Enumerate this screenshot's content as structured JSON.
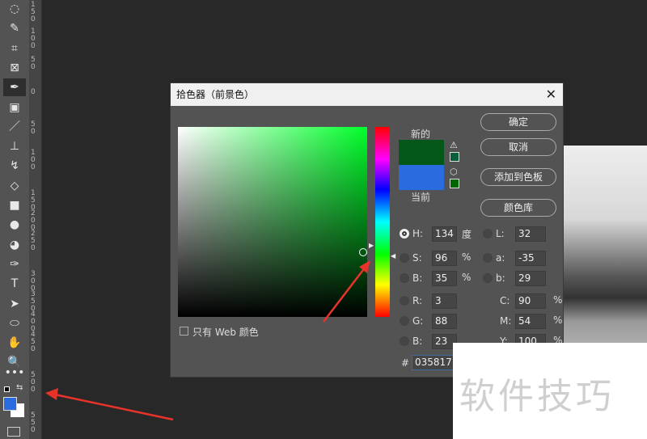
{
  "toolbar": {
    "tools": [
      {
        "name": "lasso-tool",
        "glyph": "◌"
      },
      {
        "name": "magic-wand-tool",
        "glyph": "✎"
      },
      {
        "name": "crop-tool",
        "glyph": "⌗"
      },
      {
        "name": "frame-tool",
        "glyph": "⊠"
      },
      {
        "name": "eyedropper-tool",
        "glyph": "✒",
        "active": true
      },
      {
        "name": "patch-tool",
        "glyph": "▣"
      },
      {
        "name": "brush-tool",
        "glyph": "／"
      },
      {
        "name": "stamp-tool",
        "glyph": "⊥"
      },
      {
        "name": "history-brush-tool",
        "glyph": "↯"
      },
      {
        "name": "eraser-tool",
        "glyph": "◇"
      },
      {
        "name": "gradient-tool",
        "glyph": "■"
      },
      {
        "name": "blur-tool",
        "glyph": "●"
      },
      {
        "name": "dodge-tool",
        "glyph": "◕"
      },
      {
        "name": "pen-tool",
        "glyph": "✑"
      },
      {
        "name": "type-tool",
        "glyph": "T"
      },
      {
        "name": "path-select-tool",
        "glyph": "➤"
      },
      {
        "name": "ellipse-tool",
        "glyph": "⬭"
      },
      {
        "name": "hand-tool",
        "glyph": "✋"
      },
      {
        "name": "zoom-tool",
        "glyph": "🔍"
      },
      {
        "name": "more-tools",
        "glyph": "•••"
      }
    ],
    "foreground_color": "#2b6be0",
    "background_color": "#ffffff"
  },
  "ruler": {
    "labels": [
      "150",
      "100",
      "50",
      "0",
      "50",
      "100",
      "150",
      "200",
      "250",
      "300",
      "350",
      "400",
      "450",
      "500",
      "550"
    ]
  },
  "dialog": {
    "title": "拾色器（前景色）",
    "new_label": "新的",
    "current_label": "当前",
    "new_color": "#035817",
    "current_color": "#2b6be0",
    "buttons": {
      "ok": "确定",
      "cancel": "取消",
      "add_swatch": "添加到色板",
      "color_library": "颜色库"
    },
    "fields": {
      "H": {
        "label": "H:",
        "value": "134",
        "unit": "度"
      },
      "S": {
        "label": "S:",
        "value": "96",
        "unit": "%"
      },
      "Bv": {
        "label": "B:",
        "value": "35",
        "unit": "%"
      },
      "R": {
        "label": "R:",
        "value": "3"
      },
      "G": {
        "label": "G:",
        "value": "88"
      },
      "Bc": {
        "label": "B:",
        "value": "23"
      },
      "L": {
        "label": "L:",
        "value": "32"
      },
      "a": {
        "label": "a:",
        "value": "-35"
      },
      "b": {
        "label": "b:",
        "value": "29"
      },
      "C": {
        "label": "C:",
        "value": "90",
        "unit": "%"
      },
      "M": {
        "label": "M:",
        "value": "54",
        "unit": "%"
      },
      "Y": {
        "label": "Y:",
        "value": "100",
        "unit": "%"
      }
    },
    "hex_label": "#",
    "hex_value": "035817",
    "web_only_label": "只有 Web 颜色"
  },
  "watermark": "软件技巧",
  "colors": {
    "annotation_arrow": "#e8332a"
  }
}
